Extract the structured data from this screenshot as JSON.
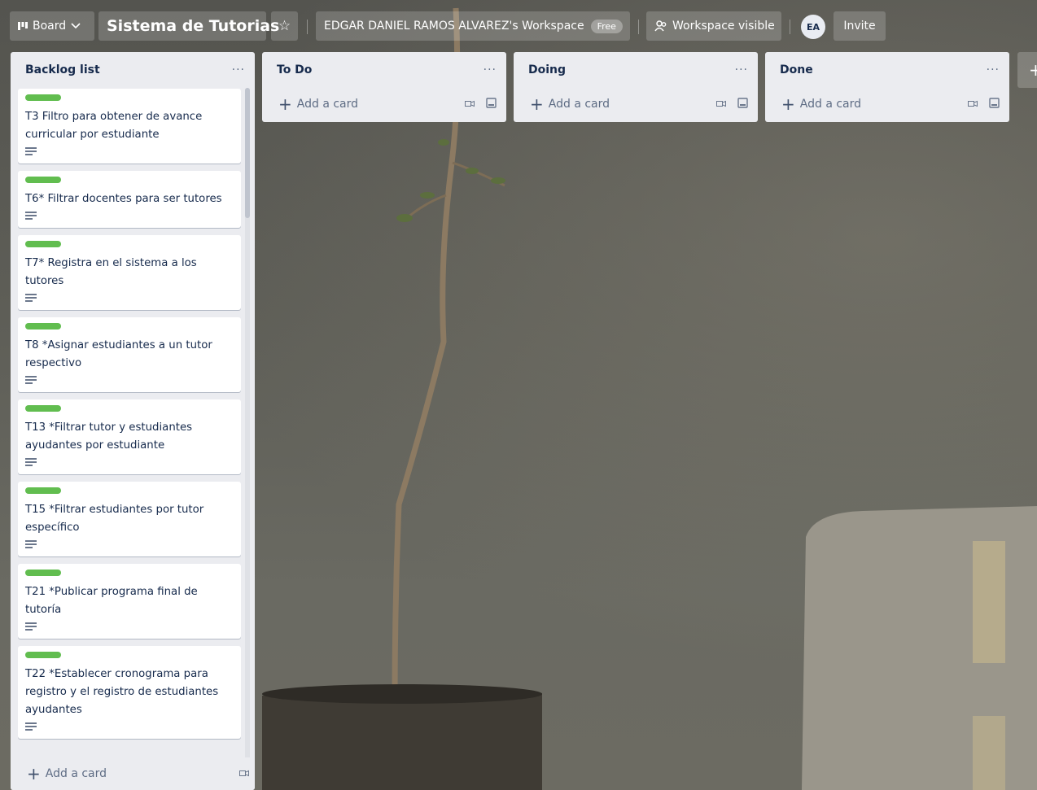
{
  "topbar": {
    "view_label": "Board",
    "board_title": "Sistema de Tutorias",
    "workspace_label": "EDGAR DANIEL RAMOS ALVAREZ's Workspace",
    "plan_badge": "Free",
    "visibility_label": "Workspace visible",
    "avatar_initials": "EA",
    "invite_label": "Invite"
  },
  "colors": {
    "label_green": "#61bd4f",
    "list_bg": "#ebecf0"
  },
  "lists": [
    {
      "title": "Backlog list",
      "menu": "···",
      "add_card": "Add a card",
      "cards": [
        {
          "text": "T3 Filtro para obtener de avance curricular por estudiante"
        },
        {
          "text": "T6* Filtrar docentes para ser tutores"
        },
        {
          "text": "T7* Registra en el sistema a los tutores"
        },
        {
          "text": "T8 *Asignar estudiantes a un tutor respectivo"
        },
        {
          "text": "T13 *Filtrar tutor y estudiantes ayudantes por estudiante"
        },
        {
          "text": "T15 *Filtrar estudiantes por tutor específico"
        },
        {
          "text": "T21 *Publicar programa final de tutoría"
        },
        {
          "text": "T22 *Establecer cronograma para registro y el registro de estudiantes ayudantes"
        }
      ]
    },
    {
      "title": "To Do",
      "menu": "···",
      "add_card": "Add a card"
    },
    {
      "title": "Doing",
      "menu": "···",
      "add_card": "Add a card"
    },
    {
      "title": "Done",
      "menu": "···",
      "add_card": "Add a card"
    }
  ]
}
